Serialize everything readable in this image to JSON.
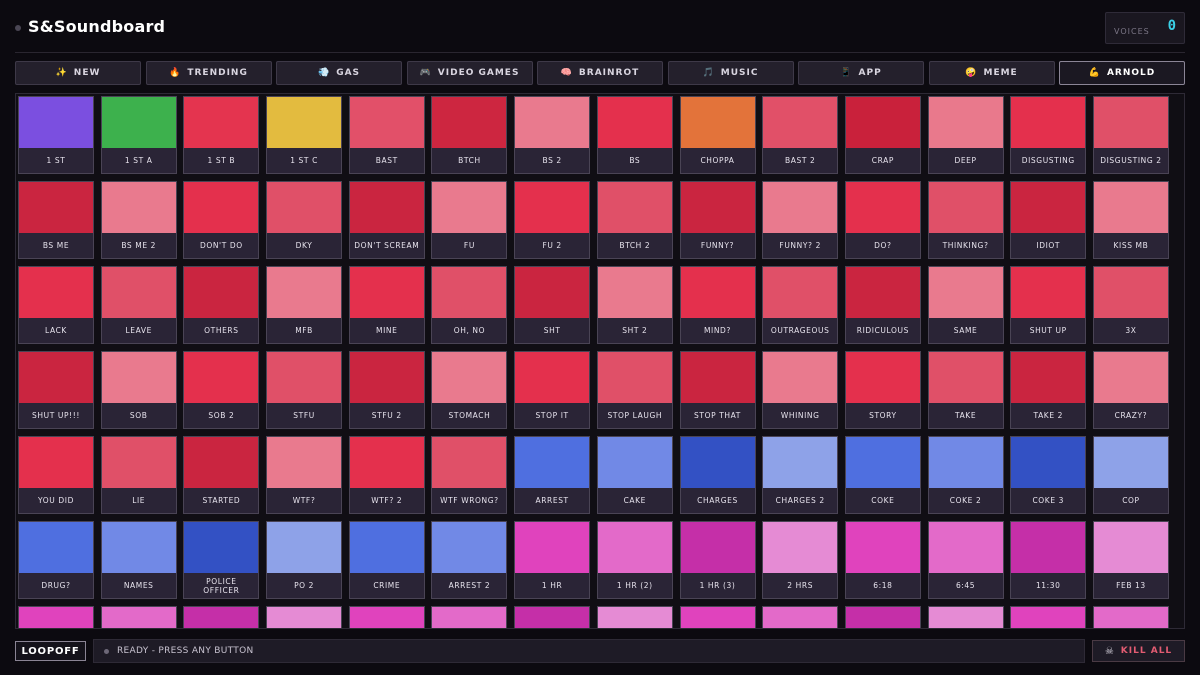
{
  "app": {
    "title": "S&Soundboard",
    "voices_label": "VOICES",
    "voices_count": "0"
  },
  "tabs": [
    {
      "label": "NEW",
      "icon": "sparkles-icon",
      "glyph": "✨",
      "active": false
    },
    {
      "label": "TRENDING",
      "icon": "fire-icon",
      "glyph": "🔥",
      "active": false
    },
    {
      "label": "GAS",
      "icon": "dash-icon",
      "glyph": "💨",
      "active": false
    },
    {
      "label": "VIDEO GAMES",
      "icon": "gamepad-icon",
      "glyph": "🎮",
      "active": false
    },
    {
      "label": "BRAINROT",
      "icon": "brain-icon",
      "glyph": "🧠",
      "active": false
    },
    {
      "label": "MUSIC",
      "icon": "music-note-icon",
      "glyph": "🎵",
      "active": false
    },
    {
      "label": "APP",
      "icon": "phone-icon",
      "glyph": "📱",
      "active": false
    },
    {
      "label": "MEME",
      "icon": "face-icon",
      "glyph": "🤪",
      "active": false
    },
    {
      "label": "ARNOLD",
      "icon": "flexed-arm-icon",
      "glyph": "💪",
      "active": true
    }
  ],
  "pads": [
    {
      "label": "1 ST",
      "color": "#7b4fe0"
    },
    {
      "label": "1 ST A",
      "color": "#3db14d"
    },
    {
      "label": "1 ST B",
      "color": "#e4344f"
    },
    {
      "label": "1 ST C",
      "color": "#e3bb3f"
    },
    {
      "label": "BAST",
      "color": "#e25069"
    },
    {
      "label": "BTCH",
      "color": "#cd2640"
    },
    {
      "label": "BS 2",
      "color": "#e97a8e"
    },
    {
      "label": "BS",
      "color": "#e4304d"
    },
    {
      "label": "CHOPPA",
      "color": "#e3733a"
    },
    {
      "label": "BAST 2",
      "color": "#e15068"
    },
    {
      "label": "CRAP",
      "color": "#c9213b"
    },
    {
      "label": "DEEP",
      "color": "#e9798c"
    },
    {
      "label": "DISGUSTING",
      "color": "#e4304d"
    },
    {
      "label": "DISGUSTING 2",
      "color": "#e05068"
    },
    {
      "label": "BS ME",
      "color": "#ca2540"
    },
    {
      "label": "BS ME 2",
      "color": "#e97a8e"
    },
    {
      "label": "DON'T DO",
      "color": "#e4304d"
    },
    {
      "label": "DKY",
      "color": "#e05068"
    },
    {
      "label": "DON'T SCREAM",
      "color": "#ca2540"
    },
    {
      "label": "FU",
      "color": "#e97a8e"
    },
    {
      "label": "FU 2",
      "color": "#e4304d"
    },
    {
      "label": "BTCH 2",
      "color": "#e05068"
    },
    {
      "label": "FUNNY?",
      "color": "#ca2540"
    },
    {
      "label": "FUNNY? 2",
      "color": "#e97a8e"
    },
    {
      "label": "DO?",
      "color": "#e4304d"
    },
    {
      "label": "THINKING?",
      "color": "#e05068"
    },
    {
      "label": "IDIOT",
      "color": "#ca2540"
    },
    {
      "label": "KISS MB",
      "color": "#e97a8e"
    },
    {
      "label": "LACK",
      "color": "#e4304d"
    },
    {
      "label": "LEAVE",
      "color": "#e05068"
    },
    {
      "label": "OTHERS",
      "color": "#ca2540"
    },
    {
      "label": "MFB",
      "color": "#e97a8e"
    },
    {
      "label": "MINE",
      "color": "#e4304d"
    },
    {
      "label": "OH, NO",
      "color": "#e05068"
    },
    {
      "label": "SHT",
      "color": "#ca2540"
    },
    {
      "label": "SHT 2",
      "color": "#e97a8e"
    },
    {
      "label": "MIND?",
      "color": "#e4304d"
    },
    {
      "label": "OUTRAGEOUS",
      "color": "#e05068"
    },
    {
      "label": "RIDICULOUS",
      "color": "#ca2540"
    },
    {
      "label": "SAME",
      "color": "#e97a8e"
    },
    {
      "label": "SHUT UP",
      "color": "#e4304d"
    },
    {
      "label": "3X",
      "color": "#e05068"
    },
    {
      "label": "SHUT UP!!!",
      "color": "#ca2540"
    },
    {
      "label": "SOB",
      "color": "#e97a8e"
    },
    {
      "label": "SOB 2",
      "color": "#e4304d"
    },
    {
      "label": "STFU",
      "color": "#e05068"
    },
    {
      "label": "STFU 2",
      "color": "#ca2540"
    },
    {
      "label": "STOMACH",
      "color": "#e97a8e"
    },
    {
      "label": "STOP IT",
      "color": "#e4304d"
    },
    {
      "label": "STOP LAUGH",
      "color": "#e05068"
    },
    {
      "label": "STOP THAT",
      "color": "#ca2540"
    },
    {
      "label": "WHINING",
      "color": "#e97a8e"
    },
    {
      "label": "STORY",
      "color": "#e4304d"
    },
    {
      "label": "TAKE",
      "color": "#e05068"
    },
    {
      "label": "TAKE 2",
      "color": "#ca2540"
    },
    {
      "label": "CRAZY?",
      "color": "#e97a8e"
    },
    {
      "label": "YOU DID",
      "color": "#e4304d"
    },
    {
      "label": "LIE",
      "color": "#e05068"
    },
    {
      "label": "STARTED",
      "color": "#ca2540"
    },
    {
      "label": "WTF?",
      "color": "#e97a8e"
    },
    {
      "label": "WTF? 2",
      "color": "#e4304d"
    },
    {
      "label": "WTF WRONG?",
      "color": "#e05068"
    },
    {
      "label": "ARREST",
      "color": "#4f6fe0"
    },
    {
      "label": "CAKE",
      "color": "#7189e6"
    },
    {
      "label": "CHARGES",
      "color": "#3351c4"
    },
    {
      "label": "CHARGES 2",
      "color": "#8ea2e8"
    },
    {
      "label": "COKE",
      "color": "#4f6fe0"
    },
    {
      "label": "COKE 2",
      "color": "#7189e6"
    },
    {
      "label": "COKE 3",
      "color": "#3351c4"
    },
    {
      "label": "COP",
      "color": "#8ea2e8"
    },
    {
      "label": "DRUG?",
      "color": "#4f6fe0"
    },
    {
      "label": "NAMES",
      "color": "#7189e6"
    },
    {
      "label": "POLICE OFFICER",
      "color": "#3351c4"
    },
    {
      "label": "PO 2",
      "color": "#8ea2e8"
    },
    {
      "label": "CRIME",
      "color": "#4f6fe0"
    },
    {
      "label": "ARREST 2",
      "color": "#7189e6"
    },
    {
      "label": "1 HR",
      "color": "#e043bd"
    },
    {
      "label": "1 HR (2)",
      "color": "#e36ac9"
    },
    {
      "label": "1 HR (3)",
      "color": "#c52fa8"
    },
    {
      "label": "2 HRS",
      "color": "#e58bd4"
    },
    {
      "label": "6:18",
      "color": "#e043bd"
    },
    {
      "label": "6:45",
      "color": "#e36ac9"
    },
    {
      "label": "11:30",
      "color": "#c52fa8"
    },
    {
      "label": "FEB 13",
      "color": "#e58bd4"
    },
    {
      "label": "",
      "color": "#e043bd"
    },
    {
      "label": "",
      "color": "#e36ac9"
    },
    {
      "label": "",
      "color": "#c52fa8"
    },
    {
      "label": "",
      "color": "#e58bd4"
    },
    {
      "label": "",
      "color": "#e043bd"
    },
    {
      "label": "",
      "color": "#e36ac9"
    },
    {
      "label": "",
      "color": "#c52fa8"
    },
    {
      "label": "",
      "color": "#e58bd4"
    },
    {
      "label": "",
      "color": "#e043bd"
    },
    {
      "label": "",
      "color": "#e36ac9"
    },
    {
      "label": "",
      "color": "#c52fa8"
    },
    {
      "label": "",
      "color": "#e58bd4"
    },
    {
      "label": "",
      "color": "#e043bd"
    },
    {
      "label": "",
      "color": "#e36ac9"
    }
  ],
  "footer": {
    "loop_label": "LOOPOFF",
    "status_text": "READY - PRESS ANY BUTTON",
    "kill_label": "KILL ALL",
    "kill_icon": "skull-crossbones-icon"
  }
}
